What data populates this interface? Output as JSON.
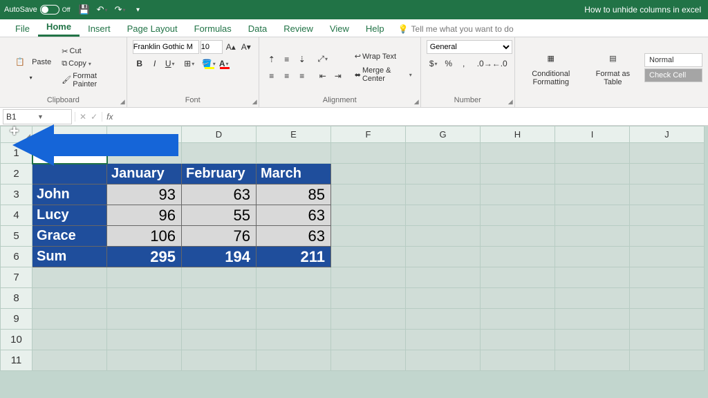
{
  "titlebar": {
    "autosave_label": "AutoSave",
    "autosave_state": "Off",
    "document_title": "How to unhide columns in excel"
  },
  "tabs": {
    "file": "File",
    "home": "Home",
    "insert": "Insert",
    "page_layout": "Page Layout",
    "formulas": "Formulas",
    "data": "Data",
    "review": "Review",
    "view": "View",
    "help": "Help",
    "tell_me": "Tell me what you want to do"
  },
  "ribbon": {
    "clipboard": {
      "paste": "Paste",
      "cut": "Cut",
      "copy": "Copy",
      "format_painter": "Format Painter",
      "label": "Clipboard"
    },
    "font": {
      "name": "Franklin Gothic M",
      "size": "10",
      "label": "Font"
    },
    "alignment": {
      "wrap": "Wrap Text",
      "merge": "Merge & Center",
      "label": "Alignment"
    },
    "number": {
      "format": "General",
      "label": "Number"
    },
    "styles": {
      "cond": "Conditional\nFormatting",
      "table": "Format as\nTable",
      "normal": "Normal",
      "check": "Check Cell"
    }
  },
  "namebox": "B1",
  "columns": [
    "",
    "D",
    "E",
    "F",
    "G",
    "H",
    "I",
    "J"
  ],
  "rows": [
    "1",
    "2",
    "3",
    "4",
    "5",
    "6",
    "7",
    "8",
    "9",
    "10",
    "11"
  ],
  "col_widths": {
    "B": 108,
    "C": 108,
    "D": 108,
    "E": 108,
    "other": 108
  },
  "table": {
    "months": [
      "January",
      "February",
      "March"
    ],
    "people": [
      "John",
      "Lucy",
      "Grace"
    ],
    "sum_label": "Sum",
    "values": [
      [
        93,
        63,
        85
      ],
      [
        96,
        55,
        63
      ],
      [
        106,
        76,
        63
      ]
    ],
    "sums": [
      295,
      194,
      211
    ]
  },
  "chart_data": {
    "type": "table",
    "title": "Monthly values by person",
    "columns": [
      "January",
      "February",
      "March"
    ],
    "rows": [
      "John",
      "Lucy",
      "Grace",
      "Sum"
    ],
    "values": [
      [
        93,
        63,
        85
      ],
      [
        96,
        55,
        63
      ],
      [
        106,
        76,
        63
      ],
      [
        295,
        194,
        211
      ]
    ]
  },
  "colors": {
    "excel_green": "#217346",
    "table_blue": "#1f4e9c",
    "arrow_blue": "#1565d8"
  }
}
